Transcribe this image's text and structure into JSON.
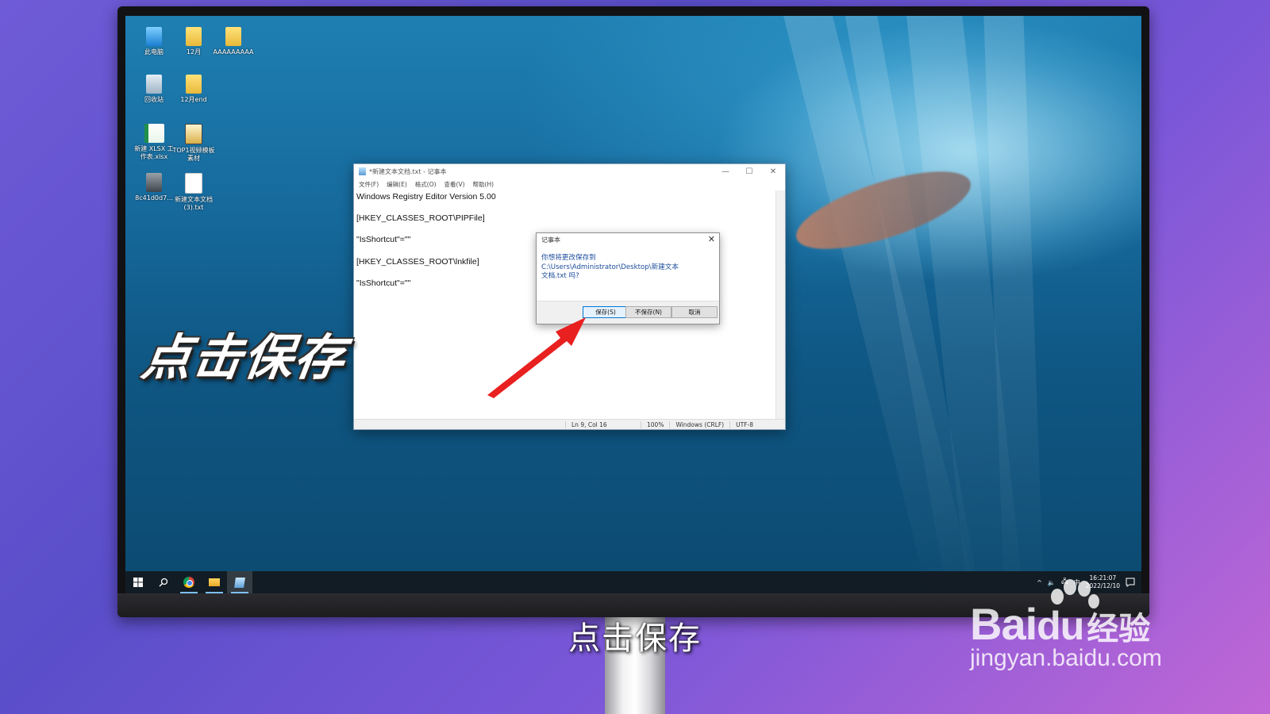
{
  "desktop": {
    "icons": [
      {
        "label": "此电脑",
        "icon": "computer-icon"
      },
      {
        "label": "12月",
        "icon": "folder-icon"
      },
      {
        "label": "AAAAAAAAA",
        "icon": "folder-icon"
      },
      {
        "label": "回收站",
        "icon": "recycle-bin-icon"
      },
      {
        "label": "12月end",
        "icon": "folder-icon"
      },
      {
        "label": "新建 XLSX 工作表.xlsx",
        "icon": "xlsx-file-icon"
      },
      {
        "label": "TOP1视频模板素材",
        "icon": "video-file-icon"
      },
      {
        "label": "8c41d0d7...",
        "icon": "image-file-icon"
      },
      {
        "label": "新建文本文档 (3).txt",
        "icon": "text-file-icon"
      }
    ]
  },
  "notepad": {
    "title": "*新建文本文档.txt - 记事本",
    "menu": [
      "文件(F)",
      "编辑(E)",
      "格式(O)",
      "查看(V)",
      "帮助(H)"
    ],
    "window_buttons": {
      "minimize": "—",
      "maximize": "☐",
      "close": "✕"
    },
    "content": [
      "Windows Registry Editor Version 5.00",
      "",
      "[HKEY_CLASSES_ROOT\\PIPFile]",
      "",
      "\"IsShortcut\"=\"\"",
      "",
      "[HKEY_CLASSES_ROOT\\lnkfile]",
      "",
      "\"IsShortcut\"=\"\""
    ],
    "status": {
      "position": "Ln 9, Col 16",
      "zoom": "100%",
      "line_ending": "Windows (CRLF)",
      "encoding": "UTF-8"
    }
  },
  "dialog": {
    "title": "记事本",
    "close": "✕",
    "message_line1": "你想将更改保存到",
    "message_line2": "C:\\Users\\Administrator\\Desktop\\新建文本",
    "message_line3": "文档.txt 吗?",
    "buttons": {
      "save": "保存(S)",
      "dont_save": "不保存(N)",
      "cancel": "取消"
    }
  },
  "taskbar": {
    "apps": [
      "start-icon",
      "search-icon",
      "chrome-icon",
      "file-explorer-icon",
      "notepad-icon"
    ],
    "tray": {
      "chevron": "^",
      "volume": "🔈",
      "network": "🖧",
      "ime": "中"
    },
    "clock_time": "16:21:07",
    "clock_date": "2022/12/10"
  },
  "overlay": {
    "big_caption": "点击保存",
    "sub_caption": "点击保存"
  },
  "watermark": {
    "brand": "Bai",
    "brand_suffix": "经验",
    "url": "jingyan.baidu.com"
  },
  "colors": {
    "accent": "#0078d7",
    "dialog_text": "#1b4d9c",
    "arrow": "#e8201f"
  }
}
